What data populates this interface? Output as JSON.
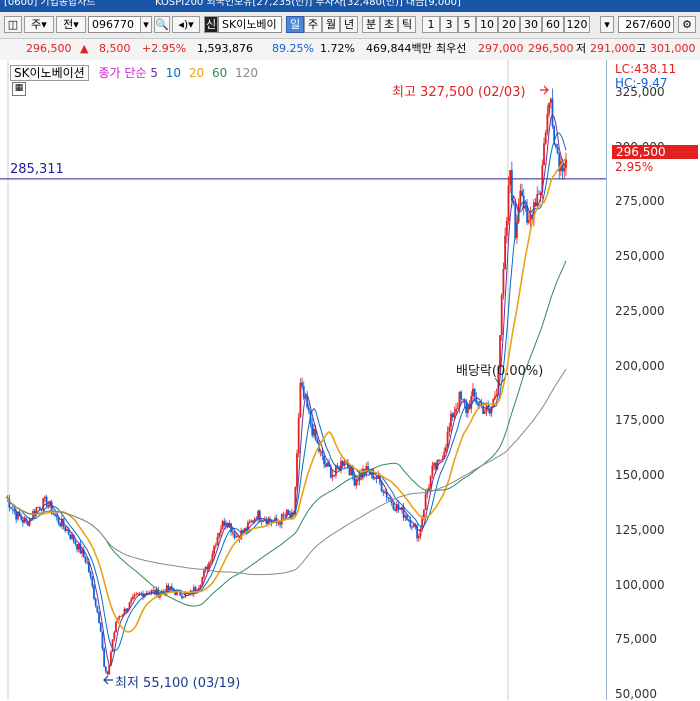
{
  "window": {
    "title_parts": [
      "[0600] 기업종합차트",
      "KOSPI200 외국인보유[27,235(만)] 투자자[32,480(만)] 대금[9,000]"
    ]
  },
  "toolbar": {
    "type_label": "주",
    "prev_label": "전",
    "code": "096770",
    "stock_badge": "신",
    "stock_name": "SK이노베이",
    "periods": [
      "일",
      "주",
      "월",
      "년",
      "분",
      "초",
      "틱"
    ],
    "selected_period": "일",
    "intervals": [
      "1",
      "3",
      "5",
      "10",
      "20",
      "30",
      "60",
      "120"
    ],
    "count": "267",
    "count_total": "/600"
  },
  "quote": {
    "price": "296,500",
    "change_arrow": "▲",
    "change": "8,500",
    "change_pct": "+2.95%",
    "volume": "1,593,876",
    "ratio1": "89.25%",
    "ratio2": "1.72%",
    "amount": "469,844백만",
    "preferred_label": "최우선",
    "ask": "297,000",
    "bid": "296,500",
    "low_label": "저",
    "low": "291,000",
    "high_label": "고",
    "high": "301,000"
  },
  "legend": {
    "stock_name": "SK이노베이션",
    "ma_label": "종가 단순",
    "ma_periods": [
      "5",
      "10",
      "20",
      "60",
      "120"
    ],
    "ma_colors": [
      "#7030a0",
      "#0070c0",
      "#e8a317",
      "#2e8b57",
      "#8a8a8a"
    ],
    "lc": "LC:438.11",
    "hc": "HC:-9.47"
  },
  "annotations": {
    "hline_value": "285,311",
    "high_text": "최고 327,500 (02/03)",
    "low_text": "최저 55,100 (03/19)",
    "dividend_text": "배당락(0.00%)",
    "price_tag": "296,500",
    "price_tag_pct": "2.95%"
  },
  "colors": {
    "up": "#e32020",
    "down": "#1060d8",
    "hline": "#2020a0",
    "tag": "#e32020"
  },
  "chart_data": {
    "type": "candlestick",
    "y_axis_labels": [
      "325,000",
      "300,000",
      "275,000",
      "250,000",
      "225,000",
      "200,000",
      "175,000",
      "150,000",
      "125,000",
      "100,000",
      "75,000",
      "50,000"
    ],
    "ylim": [
      50000,
      335000
    ],
    "close_series": [
      [
        0,
        140000
      ],
      [
        6,
        132000
      ],
      [
        12,
        128000
      ],
      [
        18,
        135000
      ],
      [
        24,
        138000
      ],
      [
        30,
        130000
      ],
      [
        36,
        125000
      ],
      [
        42,
        118000
      ],
      [
        48,
        110000
      ],
      [
        52,
        95000
      ],
      [
        56,
        80000
      ],
      [
        58,
        62000
      ],
      [
        60,
        58000
      ],
      [
        63,
        75000
      ],
      [
        66,
        85000
      ],
      [
        70,
        88000
      ],
      [
        74,
        92000
      ],
      [
        78,
        95000
      ],
      [
        84,
        97000
      ],
      [
        90,
        96000
      ],
      [
        96,
        98000
      ],
      [
        102,
        96000
      ],
      [
        108,
        95000
      ],
      [
        114,
        100000
      ],
      [
        120,
        110000
      ],
      [
        126,
        125000
      ],
      [
        130,
        130000
      ],
      [
        136,
        122000
      ],
      [
        142,
        125000
      ],
      [
        148,
        132000
      ],
      [
        154,
        130000
      ],
      [
        160,
        128000
      ],
      [
        166,
        132000
      ],
      [
        170,
        130000
      ],
      [
        174,
        190000
      ],
      [
        178,
        180000
      ],
      [
        182,
        168000
      ],
      [
        188,
        155000
      ],
      [
        194,
        150000
      ],
      [
        200,
        158000
      ],
      [
        206,
        148000
      ],
      [
        212,
        152000
      ],
      [
        218,
        150000
      ],
      [
        222,
        145000
      ],
      [
        226,
        140000
      ],
      [
        230,
        136000
      ],
      [
        236,
        132000
      ],
      [
        240,
        128000
      ],
      [
        244,
        122000
      ],
      [
        248,
        140000
      ],
      [
        252,
        152000
      ],
      [
        256,
        155000
      ],
      [
        260,
        165000
      ],
      [
        264,
        178000
      ],
      [
        268,
        185000
      ],
      [
        272,
        180000
      ],
      [
        276,
        186000
      ],
      [
        280,
        182000
      ],
      [
        286,
        178000
      ],
      [
        290,
        190000
      ],
      [
        292,
        215000
      ],
      [
        295,
        255000
      ],
      [
        298,
        290000
      ],
      [
        301,
        260000
      ],
      [
        304,
        285000
      ],
      [
        308,
        262000
      ],
      [
        312,
        275000
      ],
      [
        316,
        282000
      ],
      [
        319,
        310000
      ],
      [
        322,
        322000
      ],
      [
        325,
        300000
      ],
      [
        328,
        292000
      ],
      [
        331,
        296500
      ]
    ],
    "ma_overlays": {
      "5": [],
      "10": [],
      "20": [],
      "60": [],
      "120": []
    }
  }
}
